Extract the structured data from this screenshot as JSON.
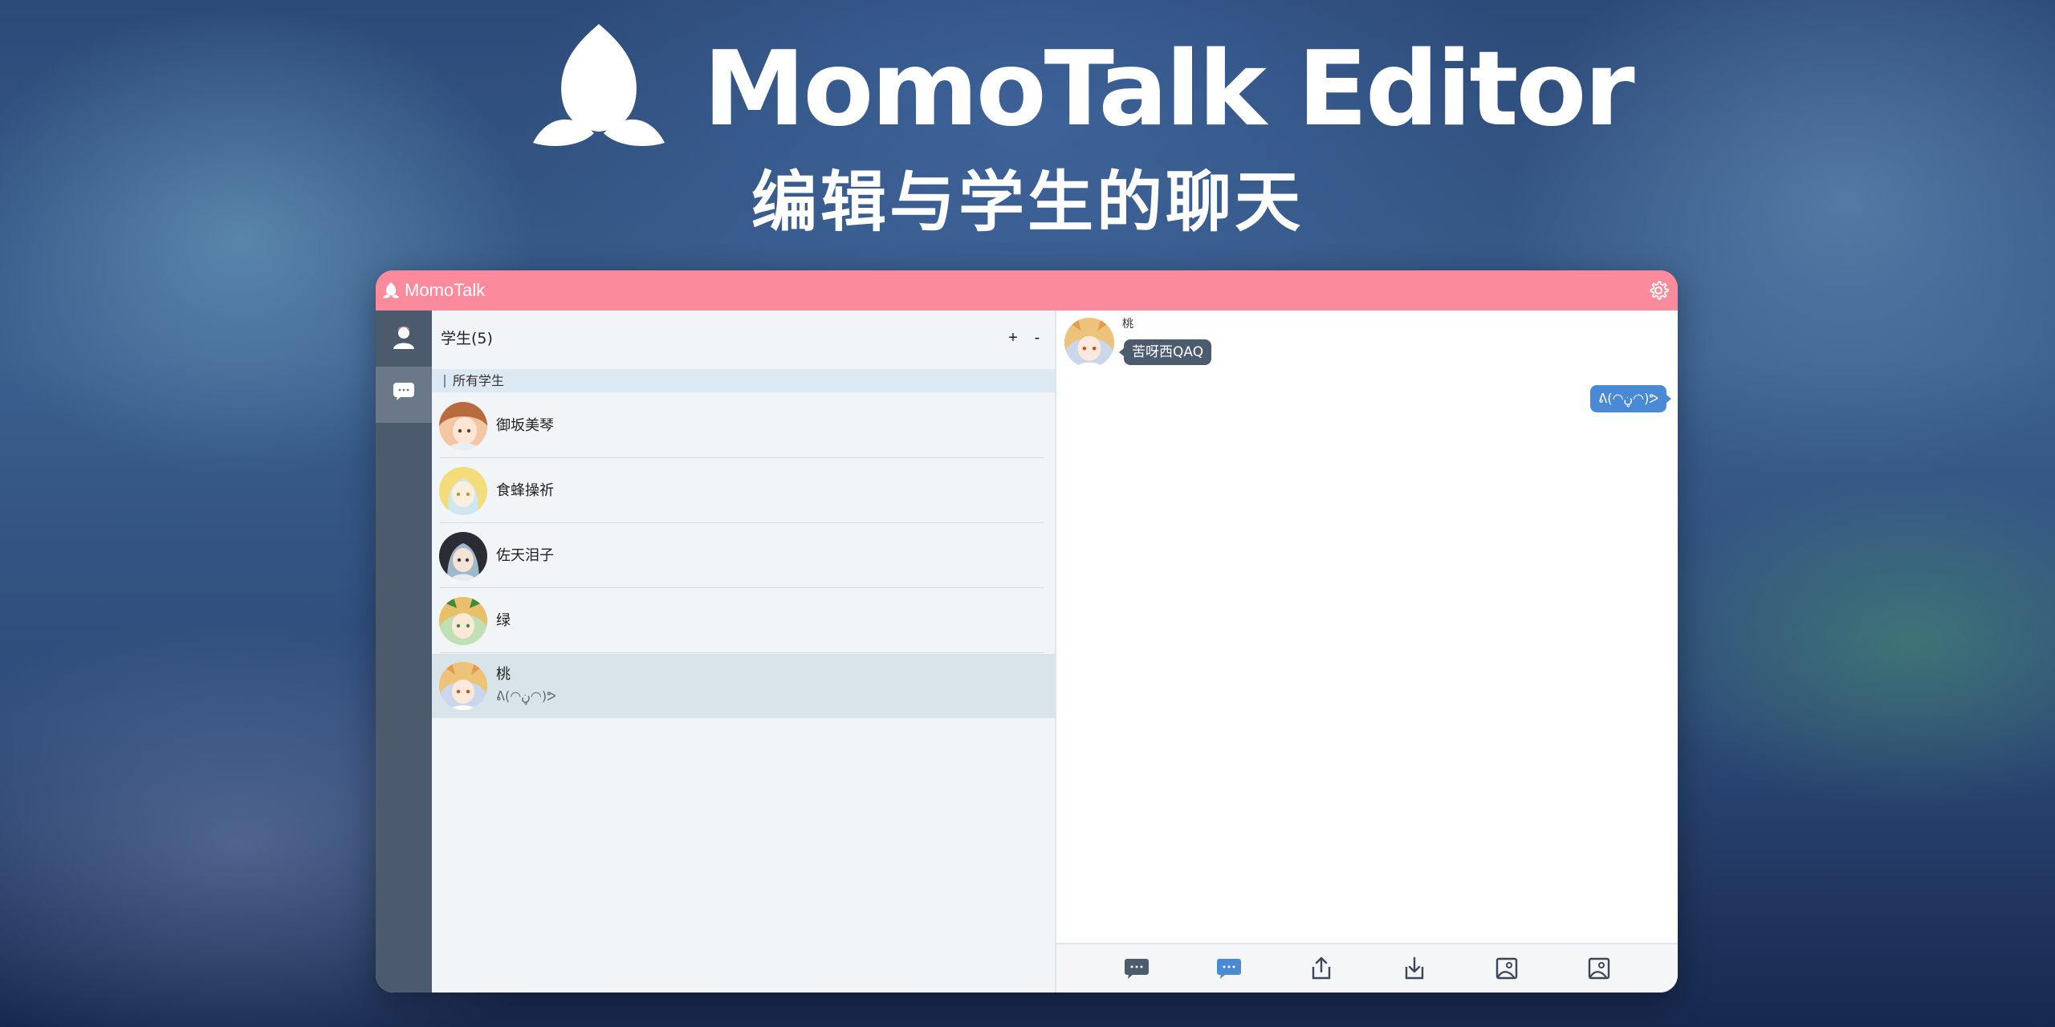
{
  "hero": {
    "title": "MomoTalk Editor",
    "subtitle": "编辑与学生的聊天",
    "logo_icon": "peach-icon"
  },
  "window": {
    "app_name": "MomoTalk",
    "settings_icon": "gear-icon",
    "accent_color": "#fa8a9c"
  },
  "sidebar": {
    "items": [
      {
        "icon": "person-icon",
        "label": "students"
      },
      {
        "icon": "chat-bubble-icon",
        "label": "chats"
      }
    ]
  },
  "students": {
    "title": "学生(5)",
    "add_label": "+",
    "remove_label": "-",
    "section": "所有学生",
    "items": [
      {
        "name": "御坂美琴",
        "preview": ""
      },
      {
        "name": "食蜂操祈",
        "preview": ""
      },
      {
        "name": "佐天泪子",
        "preview": ""
      },
      {
        "name": "绿",
        "preview": ""
      },
      {
        "name": "桃",
        "preview": "ᕕ(◠ڼ◠)ᕗ"
      }
    ],
    "selected_index": 4
  },
  "chat": {
    "messages": [
      {
        "direction": "in",
        "sender": "桃",
        "text": "苦呀西QAQ"
      },
      {
        "direction": "out",
        "text": "ᕕ(◠ڼ◠)ᕗ"
      }
    ],
    "toolbar_icons": [
      "reply-icon",
      "send-message-icon",
      "export-icon",
      "import-icon",
      "image-icon",
      "image-icon"
    ],
    "bubble_out_color": "#4a8ad4",
    "bubble_in_color": "#4d5b6f"
  }
}
